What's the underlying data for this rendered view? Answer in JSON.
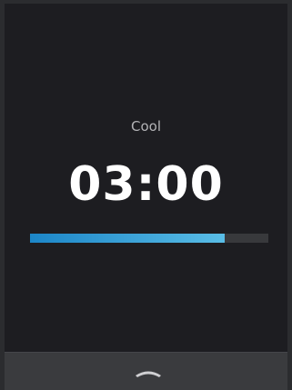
{
  "screen": {
    "mode_label": "Cool",
    "timer_text": "03:00"
  },
  "progress": {
    "fraction": 0.815
  },
  "colors": {
    "screen_background": "#1d1d21",
    "frame": "#2b2c2f",
    "bottom_bar": "#3a3b3e",
    "progress_start": "#1c86c8",
    "progress_end": "#59bde6",
    "progress_track": "#38393c",
    "text_primary": "#ffffff",
    "text_secondary": "#b3b3b6",
    "icon": "#cfcfd2"
  },
  "bottom_bar": {
    "icon": "chevron-up-icon"
  }
}
